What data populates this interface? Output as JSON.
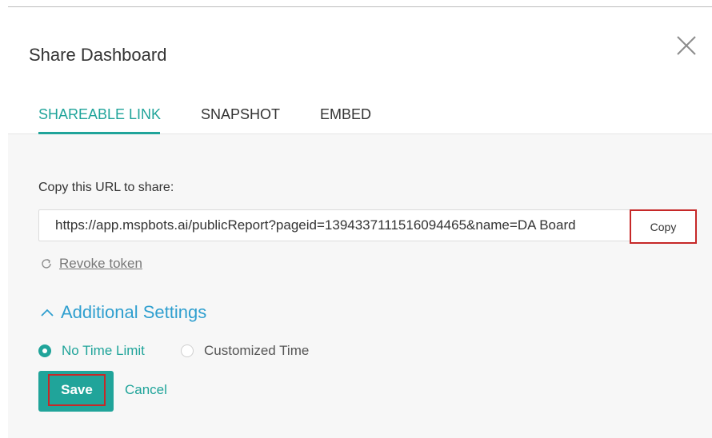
{
  "dialog": {
    "title": "Share Dashboard",
    "close_icon": "close-icon"
  },
  "tabs": [
    {
      "label": "SHAREABLE LINK",
      "active": true
    },
    {
      "label": "SNAPSHOT",
      "active": false
    },
    {
      "label": "EMBED",
      "active": false
    }
  ],
  "share": {
    "label": "Copy this URL to share:",
    "url": "https://app.mspbots.ai/publicReport?pageid=1394337111516094465&name=DA Board",
    "copy_label": "Copy",
    "revoke_label": "Revoke token",
    "revoke_icon": "refresh-icon"
  },
  "settings": {
    "toggle_label": "Additional Settings",
    "toggle_icon": "chevron-up-icon",
    "options": [
      {
        "label": "No Time Limit",
        "selected": true
      },
      {
        "label": "Customized Time",
        "selected": false
      }
    ]
  },
  "actions": {
    "save_label": "Save",
    "cancel_label": "Cancel"
  },
  "colors": {
    "accent": "#20a49a",
    "link_blue": "#2f9fcf",
    "highlight_red": "#c62828"
  }
}
